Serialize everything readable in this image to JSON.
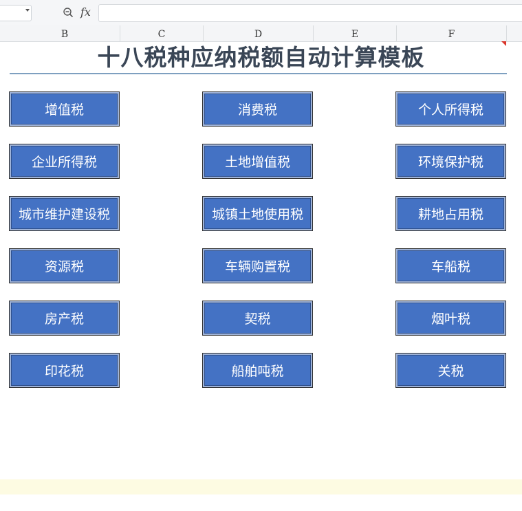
{
  "formula_bar": {
    "fx_label": "fx",
    "name_box_value": "",
    "formula_value": ""
  },
  "columns": [
    "B",
    "C",
    "D",
    "E",
    "F"
  ],
  "sheet": {
    "title": "十八税种应纳税额自动计算模板"
  },
  "tax_buttons": [
    [
      "增值税",
      "消费税",
      "个人所得税"
    ],
    [
      "企业所得税",
      "土地增值税",
      "环境保护税"
    ],
    [
      "城市维护建设税",
      "城镇土地使用税",
      "耕地占用税"
    ],
    [
      "资源税",
      "车辆购置税",
      "车船税"
    ],
    [
      "房产税",
      "契税",
      "烟叶税"
    ],
    [
      "印花税",
      "船舶吨税",
      "关税"
    ]
  ],
  "colors": {
    "button_fill": "#4472c4",
    "title_text": "#3a4656",
    "underline": "#7ea0c0"
  },
  "icons": {
    "zoom": "zoom-out-icon",
    "dropdown": "chevron-down-icon"
  }
}
